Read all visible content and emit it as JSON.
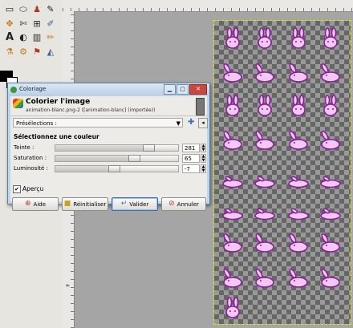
{
  "toolbox": {
    "tools": [
      "rect-select-icon",
      "ellipse-select-icon",
      "free-select-icon",
      "fuzzy-select-icon",
      "color-select-icon",
      "scissors-icon",
      "paths-icon",
      "color-picker-icon",
      "zoom-icon",
      "measure-icon",
      "move-icon",
      "align-icon",
      "crop-icon",
      "rotate-icon",
      "scale-icon",
      "shear-icon",
      "perspective-icon",
      "flip-icon",
      "text-icon",
      "bucket-fill-icon",
      "gradient-icon",
      "pencil-icon",
      "paintbrush-icon",
      "eraser-icon"
    ],
    "fg_color": "#000000",
    "bg_color": "#ffffff"
  },
  "ruler": {
    "v_labels": [
      "2",
      "3",
      "4"
    ]
  },
  "dialog": {
    "window_title": "Coloriage",
    "header_title": "Colorier l'image",
    "header_subtitle": "animation-blanc.png-2 ([animation-blanc] (importée))",
    "presets_label": "Présélections :",
    "section_title": "Sélectionnez une couleur",
    "sliders": [
      {
        "label": "Teinte :",
        "value": "281",
        "fraction": 0.78
      },
      {
        "label": "Saturation :",
        "value": "65",
        "fraction": 0.65
      },
      {
        "label": "Luminosité :",
        "value": "-7",
        "fraction": 0.47
      }
    ],
    "preview_label": "Aperçu",
    "preview_checked": true,
    "buttons": {
      "help": "Aide",
      "reset": "Réinitialiser",
      "ok": "Valider",
      "cancel": "Annuler"
    }
  },
  "colors": {
    "sprite_fill": "#f4c8f4",
    "sprite_outline": "#8a1e9a"
  }
}
